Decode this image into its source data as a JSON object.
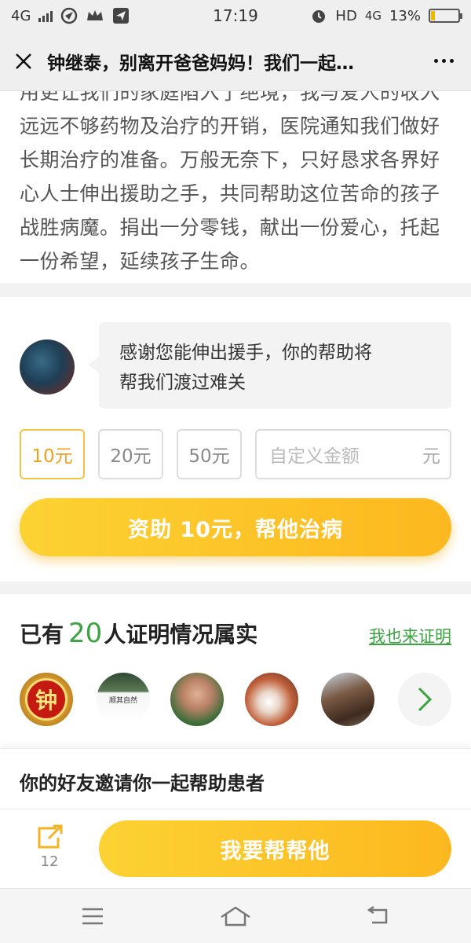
{
  "status_bar": {
    "network": "4G",
    "time": "17:19",
    "hd": "HD",
    "network2": "4G",
    "battery_text": "13%",
    "battery_level": 0.13,
    "battery_color": "#f4b400"
  },
  "title_bar": {
    "title": "钟继泰，别离开爸爸妈妈！我们一起…"
  },
  "story": {
    "text": "用更让我们的家庭陷入了绝境，我与爱人的收入远远不够药物及治疗的开销，医院通知我们做好长期治疗的准备。万般无奈下，只好恳求各界好心人士伸出援助之手，共同帮助这位苦命的孩子战胜病魔。捐出一分零钱，献出一份爱心，托起一份希望，延续孩子生命。"
  },
  "donate": {
    "message_line1": "感谢您能伸出援手，你的帮助将",
    "message_line2": "帮我们渡过难关",
    "amounts": [
      "10元",
      "20元",
      "50元"
    ],
    "custom_placeholder": "自定义金额",
    "custom_unit": "元",
    "button_label": "资助 10元，帮他治病"
  },
  "verify": {
    "prefix": "已有",
    "count": "20",
    "suffix": "人证明情况属实",
    "link": "我也来证明",
    "avatar1_char": "钟",
    "avatar2_text": "顺其自然"
  },
  "invite": {
    "text": "你的好友邀请你一起帮助患者"
  },
  "action_bar": {
    "share_count": "12",
    "help_label": "我要帮帮他"
  },
  "colors": {
    "accent_yellow": "#fcc22a",
    "accent_green": "#3aa440",
    "selected_orange": "#f0a020"
  }
}
